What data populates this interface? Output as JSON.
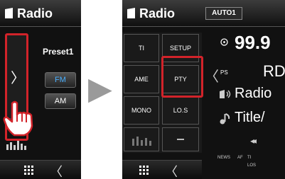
{
  "left_screen": {
    "title": "Radio",
    "preset_label": "Preset1",
    "band_fm": "FM",
    "band_am": "AM",
    "open_tab_arrow": "〉",
    "back_arrow": "〈"
  },
  "right_screen": {
    "title": "Radio",
    "source_badge": "AUTO1",
    "function_buttons": {
      "ti": "TI",
      "setup": "SETUP",
      "ame": "AME",
      "pty": "PTY",
      "mono": "MONO",
      "los": "LO.S"
    },
    "close_tab_arrow": "〈",
    "frequency": "99.9",
    "ps_label": "PS",
    "station_name": "RD",
    "radio_text": "Radio",
    "title_text": "Title/",
    "seek_symbol": "◂◂",
    "back_arrow": "〈",
    "status": {
      "news": "NEWS",
      "af": "AF",
      "ti": "TI",
      "los": "LOS"
    }
  },
  "transition_arrow": "▶",
  "colors": {
    "highlight": "#d2232a",
    "fm_active": "#4ab0ff",
    "arrow": "#9a9a9a"
  }
}
